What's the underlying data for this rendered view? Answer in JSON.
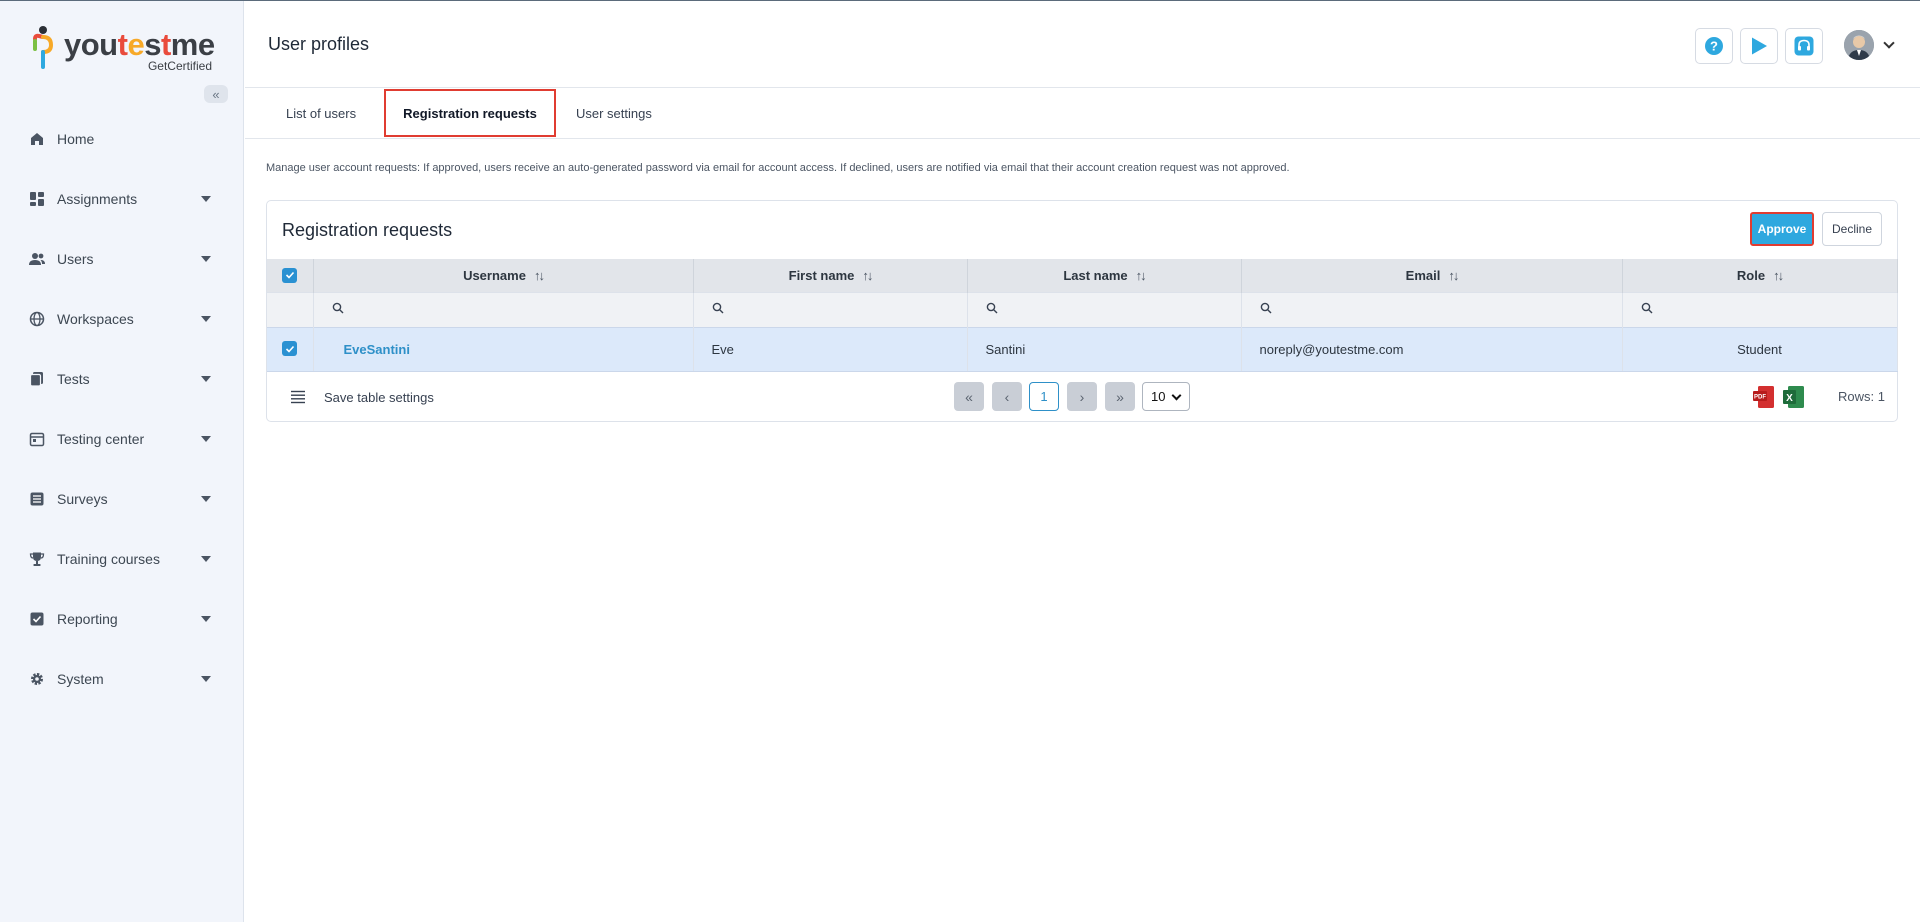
{
  "brand": {
    "name_a": "you",
    "name_b": "t",
    "name_c": "e",
    "name_d": "s",
    "name_e": "t",
    "name_f": "me",
    "tagline": "GetCertified"
  },
  "sidebar": {
    "collapse_glyph": "«",
    "items": [
      {
        "label": "Home",
        "icon": "home-icon",
        "caret": false
      },
      {
        "label": "Assignments",
        "icon": "dashboard-icon",
        "caret": true
      },
      {
        "label": "Users",
        "icon": "users-icon",
        "caret": true
      },
      {
        "label": "Workspaces",
        "icon": "globe-icon",
        "caret": true
      },
      {
        "label": "Tests",
        "icon": "tests-icon",
        "caret": true
      },
      {
        "label": "Testing center",
        "icon": "calendar-icon",
        "caret": true
      },
      {
        "label": "Surveys",
        "icon": "list-icon",
        "caret": true
      },
      {
        "label": "Training courses",
        "icon": "trophy-icon",
        "caret": true
      },
      {
        "label": "Reporting",
        "icon": "report-icon",
        "caret": true
      },
      {
        "label": "System",
        "icon": "gear-icon",
        "caret": true
      }
    ]
  },
  "header": {
    "title": "User profiles"
  },
  "tabs": [
    {
      "label": "List of users"
    },
    {
      "label": "Registration requests",
      "active": true
    },
    {
      "label": "User settings"
    }
  ],
  "description": "Manage user account requests: If approved, users receive an auto-generated password via email for account access. If declined, users are notified via email that their account creation request was not approved.",
  "panel": {
    "title": "Registration requests",
    "approve_label": "Approve",
    "decline_label": "Decline"
  },
  "table": {
    "columns": [
      "Username",
      "First name",
      "Last name",
      "Email",
      "Role"
    ],
    "rows": [
      {
        "username": "EveSantini",
        "first_name": "Eve",
        "last_name": "Santini",
        "email": "noreply@youtestme.com",
        "role": "Student",
        "selected": true
      }
    ]
  },
  "footer": {
    "save_label": "Save table settings",
    "current_page": "1",
    "page_size": "10",
    "rows_label": "Rows: 1"
  },
  "colors": {
    "accent": "#2ea8df",
    "highlight": "#e03c31",
    "selected_row": "#dce9fa"
  }
}
